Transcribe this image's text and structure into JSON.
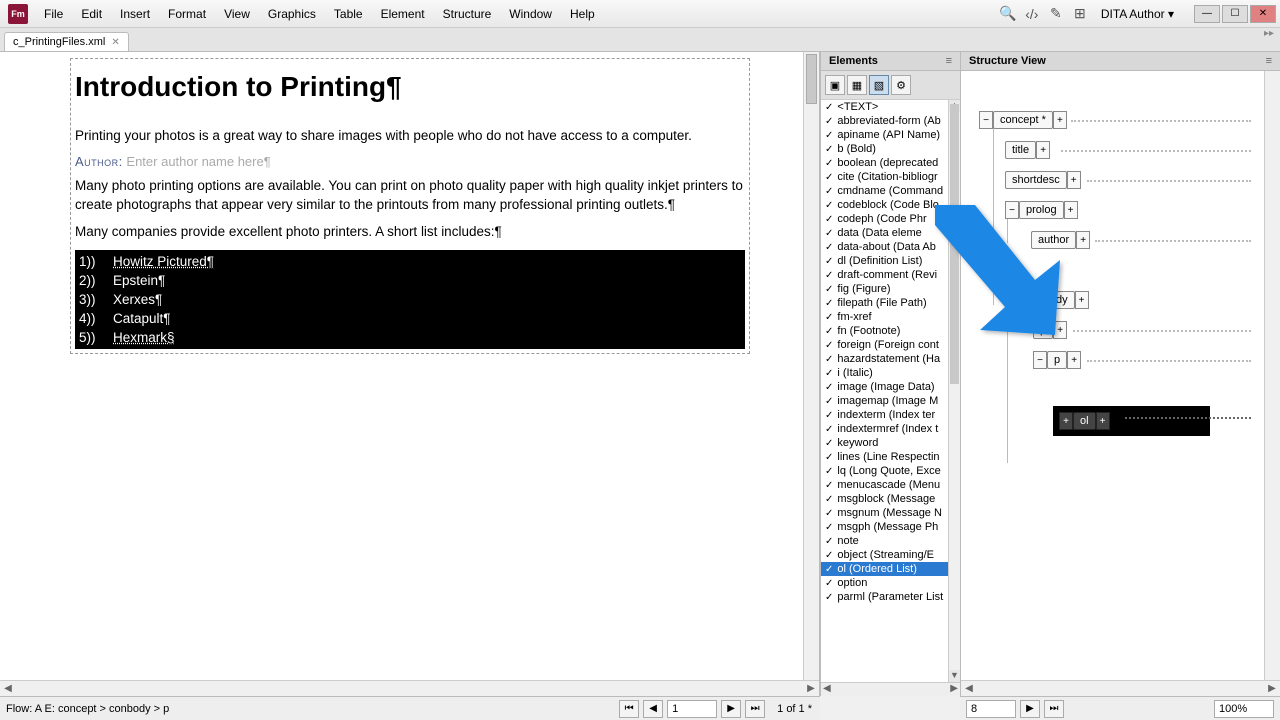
{
  "app_icon_label": "Fm",
  "menus": [
    "File",
    "Edit",
    "Insert",
    "Format",
    "View",
    "Graphics",
    "Table",
    "Element",
    "Structure",
    "Window",
    "Help"
  ],
  "workspace": "DITA Author",
  "file_tab": "c_PrintingFiles.xml",
  "document": {
    "title": "Introduction to Printing¶",
    "p1": "Printing your photos is a great way to share images with people who do not have access to a computer.",
    "author_label": "Author:",
    "author_placeholder": "Enter author name here¶",
    "p2": "Many photo printing options are available. You can print on photo quality paper with high quality inkjet printers to create photographs that appear very similar to the printouts from many professional printing outlets.¶",
    "p3": "Many companies provide excellent photo printers. A short list includes:¶",
    "list": [
      {
        "n": "1))",
        "text": "Howitz Pictured¶"
      },
      {
        "n": "2))",
        "text": "Epstein¶"
      },
      {
        "n": "3))",
        "text": "Xerxes¶"
      },
      {
        "n": "4))",
        "text": "Catapult¶"
      },
      {
        "n": "5))",
        "text": "Hexmark§"
      }
    ]
  },
  "elements_panel": {
    "title": "Elements",
    "items": [
      {
        "label": "<TEXT>"
      },
      {
        "label": "abbreviated-form  (Ab"
      },
      {
        "label": "apiname  (API Name)"
      },
      {
        "label": "b  (Bold)"
      },
      {
        "label": "boolean  (deprecated"
      },
      {
        "label": "cite  (Citation-bibliogr"
      },
      {
        "label": "cmdname  (Command"
      },
      {
        "label": "codeblock  (Code Blo"
      },
      {
        "label": "codeph  (Code Phr"
      },
      {
        "label": "data  (Data eleme"
      },
      {
        "label": "data-about  (Data Ab"
      },
      {
        "label": "dl  (Definition List)"
      },
      {
        "label": "draft-comment  (Revi"
      },
      {
        "label": "fig  (Figure)"
      },
      {
        "label": "filepath  (File Path)"
      },
      {
        "label": "fm-xref"
      },
      {
        "label": "fn  (Footnote)"
      },
      {
        "label": "foreign  (Foreign cont"
      },
      {
        "label": "hazardstatement  (Ha"
      },
      {
        "label": "i  (Italic)"
      },
      {
        "label": "image  (Image Data)"
      },
      {
        "label": "imagemap  (Image M"
      },
      {
        "label": "indexterm  (Index ter"
      },
      {
        "label": "indextermref  (Index t"
      },
      {
        "label": "keyword"
      },
      {
        "label": "lines  (Line Respectin"
      },
      {
        "label": "lq  (Long Quote, Exce"
      },
      {
        "label": "menucascade  (Menu"
      },
      {
        "label": "msgblock  (Message"
      },
      {
        "label": "msgnum  (Message N"
      },
      {
        "label": "msgph  (Message Ph"
      },
      {
        "label": "note"
      },
      {
        "label": "object  (Streaming/E"
      },
      {
        "label": "ol  (Ordered List)",
        "selected": true
      },
      {
        "label": "option"
      },
      {
        "label": "parml  (Parameter List"
      }
    ]
  },
  "structure_panel": {
    "title": "Structure View",
    "nodes": {
      "concept": "concept *",
      "title": "title",
      "shortdesc": "shortdesc",
      "prolog": "prolog",
      "author": "author",
      "conbody": "conbody",
      "p1": "p",
      "p2": "p",
      "ol": "ol"
    }
  },
  "statusbar": {
    "flow": "Flow: A  E: concept > conbody > p",
    "page_input": "1",
    "page_of": "1 of 1 *",
    "sv_page_input": "8",
    "zoom": "100%"
  },
  "glyphs": {
    "minus": "−",
    "plus": "+",
    "first": "⏮",
    "prev": "◀",
    "next": "▶",
    "last": "⏭",
    "close": "✕",
    "min": "—",
    "max": "☐",
    "search": "🔍",
    "toggle": "▾",
    "left": "◀",
    "right": "▶",
    "up": "▲",
    "down": "▼"
  }
}
